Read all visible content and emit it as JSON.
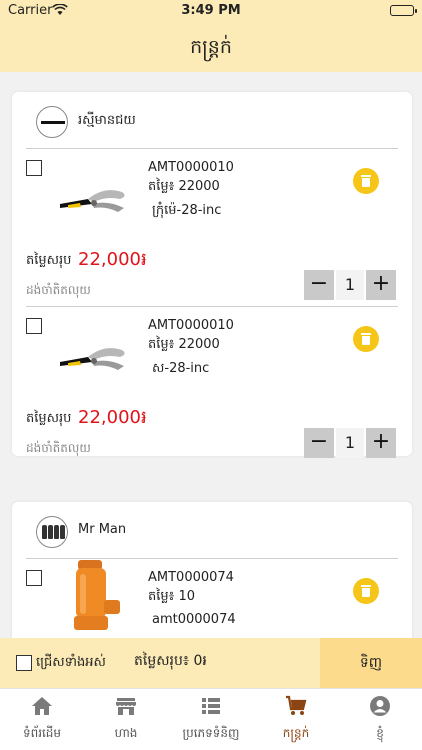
{
  "status_bar": {
    "carrier": "Carrier",
    "time": "3:49 PM"
  },
  "header": {
    "title": "កន្ត្រក់"
  },
  "stores": [
    {
      "name": "រស្មីមានជយ",
      "items": [
        {
          "code": "AMT0000010",
          "price_line": "តម្លៃ៖ 22000",
          "variant": "ក្រុំម៉េ-28-inc",
          "total_label": "តម្លៃសរុប",
          "total_value": "22,000៛",
          "note": "ដង់ចាំតិតលុយ",
          "quantity": "1"
        },
        {
          "code": "AMT0000010",
          "price_line": "តម្លៃ៖ 22000",
          "variant": "ស-28-inc",
          "total_label": "តម្លៃសរុប",
          "total_value": "22,000៛",
          "note": "ដង់ចាំតិតលុយ",
          "quantity": "1"
        }
      ]
    },
    {
      "name": "Mr Man",
      "items": [
        {
          "code": "AMT0000074",
          "price_line": "តម្លៃ៖ 10",
          "variant": "amt0000074"
        }
      ]
    }
  ],
  "checkout": {
    "select_all": "ជ្រើសទាំងអស់",
    "total": "តម្លៃសរុប៖ 0៛",
    "buy": "ទិញ"
  },
  "tabs": [
    {
      "label": "ទំព័រដើម",
      "icon": "home-icon"
    },
    {
      "label": "ហាង",
      "icon": "store-icon"
    },
    {
      "label": "ប្រភេទទំនិញ",
      "icon": "list-icon"
    },
    {
      "label": "កន្ត្រក់",
      "icon": "cart-icon",
      "active": true
    },
    {
      "label": "ខ្ញុំ",
      "icon": "user-icon"
    }
  ],
  "colors": {
    "accent_bg": "#fcebb7",
    "price_red": "#e0141b",
    "trash_yellow": "#f5c518",
    "active_tab": "#8b4513"
  }
}
